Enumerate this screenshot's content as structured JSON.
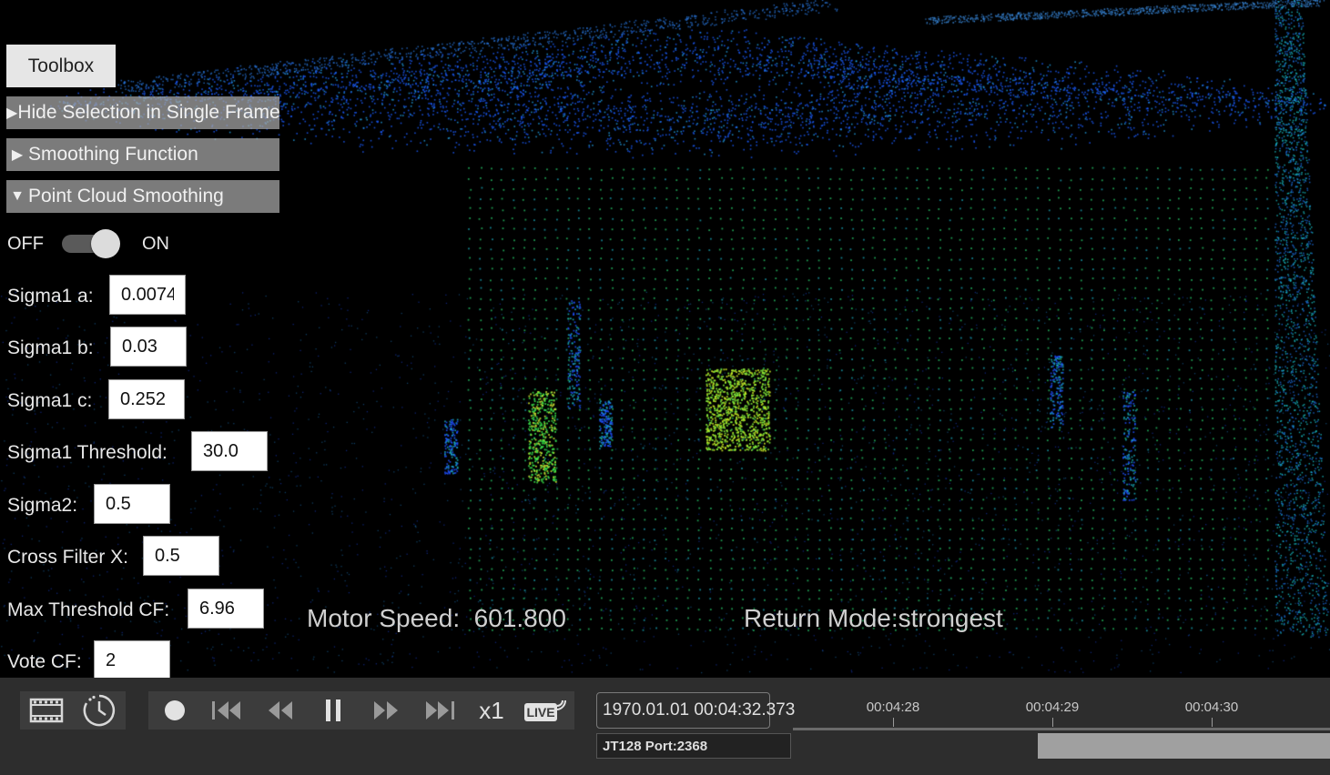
{
  "toolbox": {
    "title": "Toolbox",
    "sections": [
      {
        "label": "Hide Selection in Single Frame",
        "expanded": false
      },
      {
        "label": "Smoothing Function",
        "expanded": false
      },
      {
        "label": "Point Cloud Smoothing",
        "expanded": true
      }
    ],
    "toggle": {
      "off_label": "OFF",
      "on_label": "ON",
      "state": "on"
    },
    "params": [
      {
        "label": "Sigma1 a:",
        "value": "0.0074"
      },
      {
        "label": "Sigma1 b:",
        "value": "0.03"
      },
      {
        "label": "Sigma1 c:",
        "value": "0.252"
      },
      {
        "label": "Sigma1 Threshold:",
        "value": "30.0"
      },
      {
        "label": "Sigma2:",
        "value": "0.5"
      },
      {
        "label": "Cross Filter X:",
        "value": "0.5"
      },
      {
        "label": "Max Threshold CF:",
        "value": "6.96"
      },
      {
        "label": "Vote CF:",
        "value": "2"
      }
    ]
  },
  "overlay": {
    "motor_speed_label": "Motor Speed:",
    "motor_speed_value": "601.800",
    "return_mode_label": "Return Mode:",
    "return_mode_value": "strongest"
  },
  "playback": {
    "view_icons": [
      "film-frame-icon",
      "clock-history-icon"
    ],
    "controls": [
      "record-icon",
      "skip-to-start-icon",
      "rewind-icon",
      "pause-icon",
      "fast-forward-icon",
      "skip-to-end-icon"
    ],
    "speed": "x1",
    "live_label": "LIVE",
    "current_time": "1970.01.01 00:04:32.373",
    "device": "JT128 Port:2368",
    "ticks": [
      "00:04:28",
      "00:04:29",
      "00:04:30"
    ]
  },
  "colors": {
    "cloud_blue": "#1c5cff",
    "cloud_green": "#2ee36a",
    "cloud_cyan": "#19c2c8",
    "bottom_bar": "#2d2d2d"
  }
}
